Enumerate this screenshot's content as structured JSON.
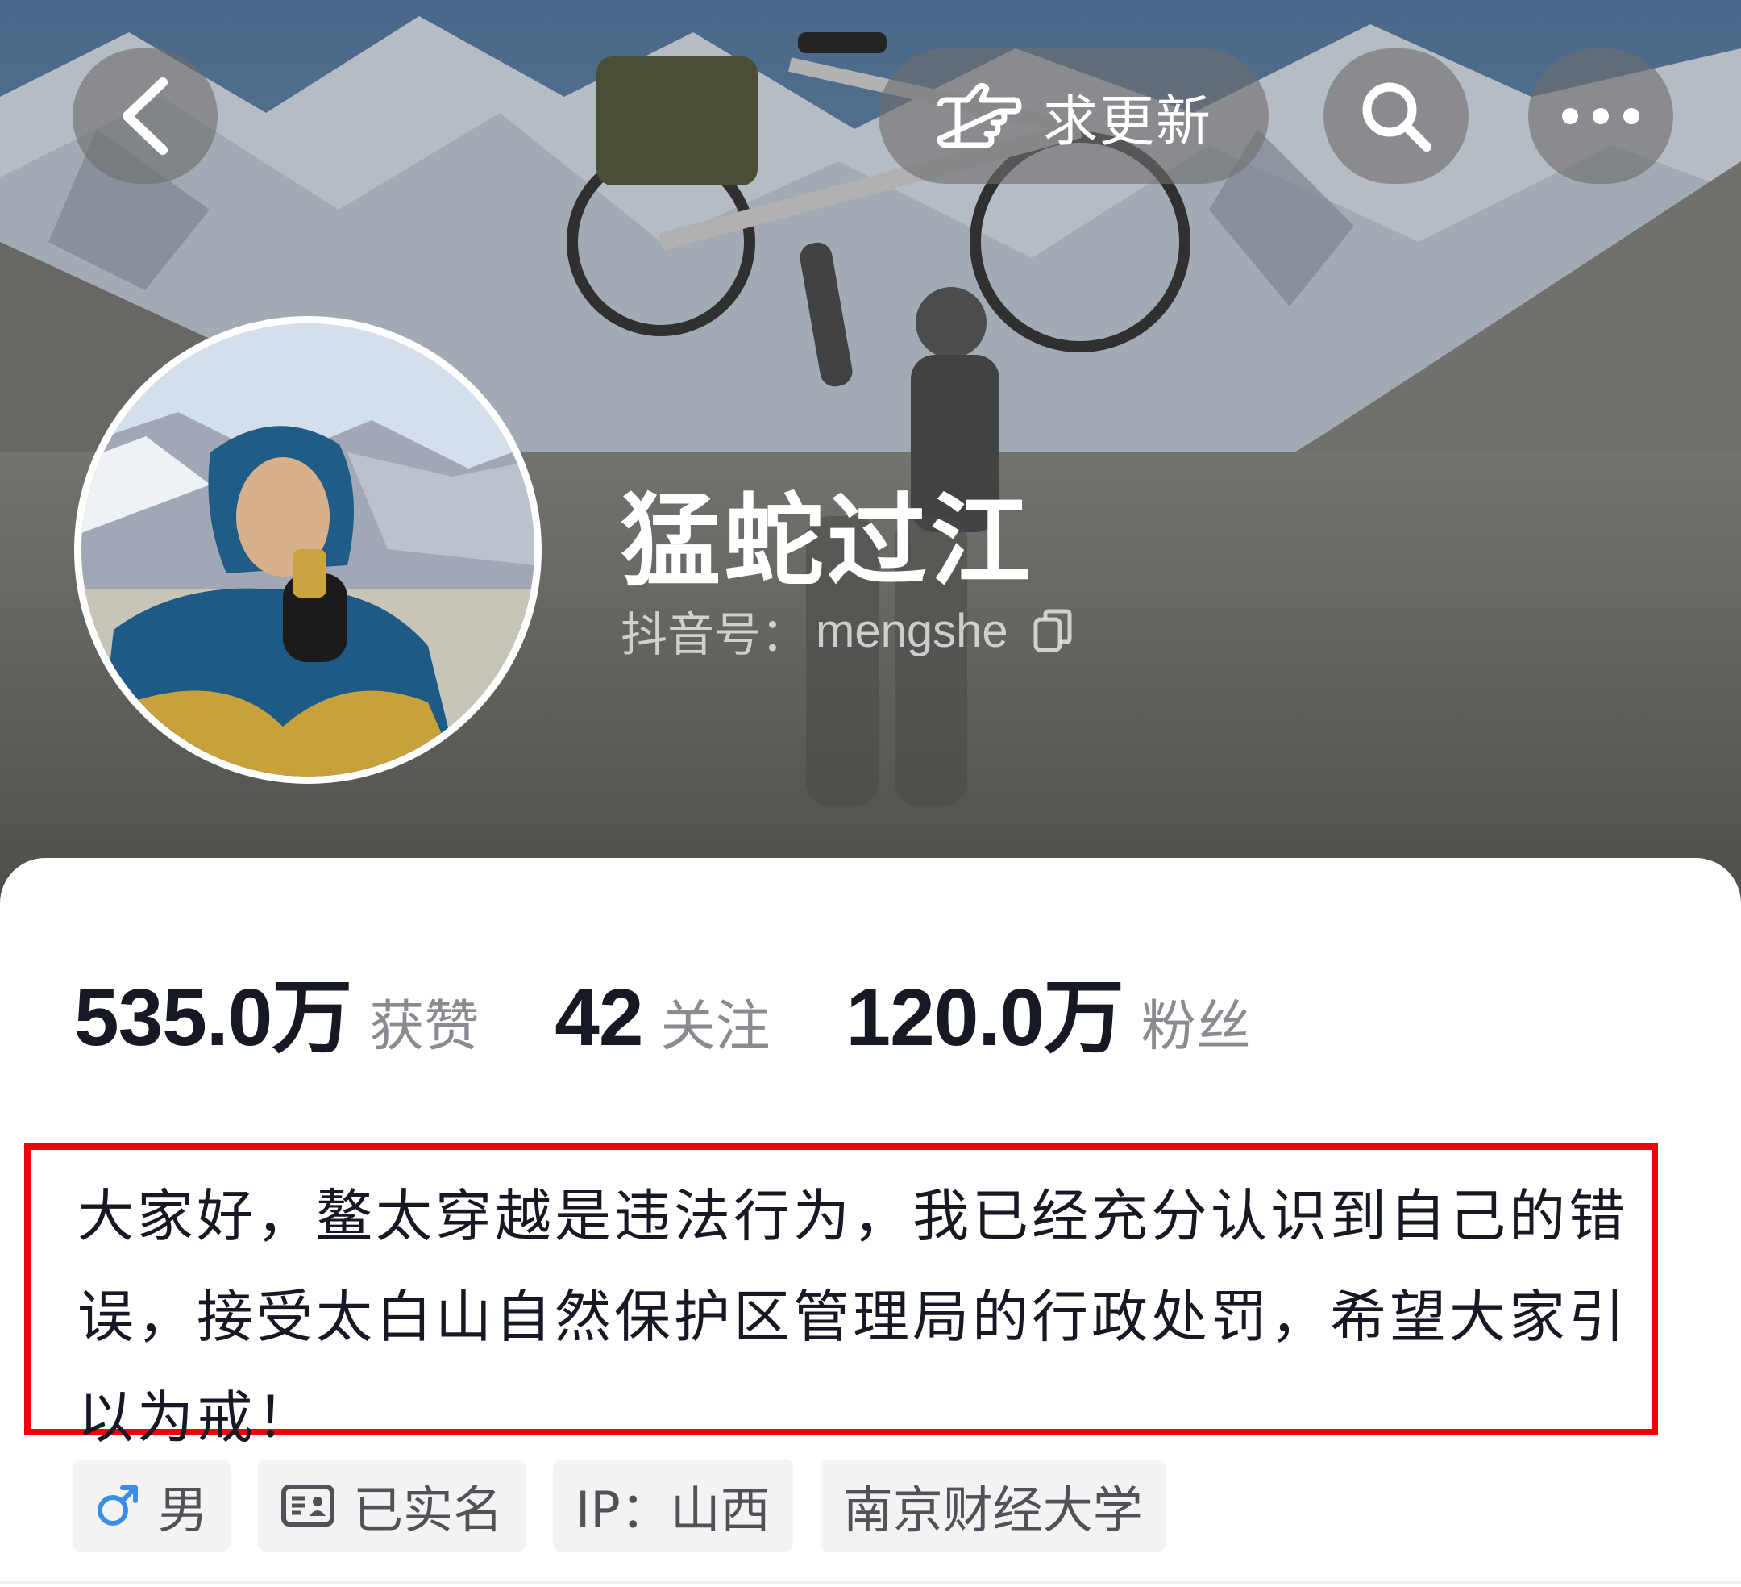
{
  "header": {
    "update_button_label": "求更新",
    "icons": {
      "back": "back-chevron-icon",
      "update": "pointing-hand-icon",
      "search": "search-icon",
      "more": "more-dots-icon",
      "copy": "copy-icon"
    }
  },
  "profile": {
    "nickname": "猛蛇过江",
    "douyin_id_label": "抖音号：",
    "douyin_id": "mengshe"
  },
  "stats": [
    {
      "value": "535.0万",
      "label": "获赞"
    },
    {
      "value": "42",
      "label": "关注"
    },
    {
      "value": "120.0万",
      "label": "粉丝"
    }
  ],
  "bio": {
    "lines": [
      "大家好，鳌太穿越是违法行为，我已经充分认识到自己的错",
      "误，接受太白山自然保护区管理局的行政处罚，希望大家引",
      "以为戒！"
    ],
    "highlight_color": "#f2000d"
  },
  "tags": [
    {
      "icon": "male-icon",
      "label": "男"
    },
    {
      "icon": "id-card-icon",
      "label": "已实名"
    },
    {
      "icon": "",
      "label": "IP：山西"
    },
    {
      "icon": "",
      "label": "南京财经大学"
    }
  ],
  "colors": {
    "male_icon": "#3a8ee6",
    "stat_number": "#161823",
    "stat_label": "#8a8b91"
  }
}
